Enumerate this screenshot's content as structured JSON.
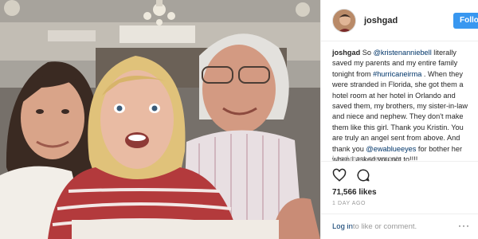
{
  "post": {
    "username": "joshgad",
    "follow_label": "Follow",
    "caption": {
      "user": "joshgad",
      "t1": " So ",
      "mention1": "@kristenanniebell",
      "t2": " literally saved my parents and my entire family tonight from ",
      "hashtag": "#hurricaneirma",
      "t3": " . When they were stranded in Florida, she got them a hotel room at her hotel in Orlando and saved them, my brothers, my sister-in-law and niece and nephew. They don't make them like this girl. Thank you Kristin. You are truly an angel sent from above. And thank you ",
      "mention2": "@ewablueeyes",
      "t4": " for bother her when I asked you not to!!!!"
    },
    "load_more": "Load more comments",
    "likes": "71,566 likes",
    "time": "1 DAY AGO",
    "login_link": "Log in",
    "comment_prompt": " to like or comment.",
    "more_glyph": "···"
  },
  "icons": {
    "like": "heart-icon",
    "comment": "comment-icon",
    "more": "more-options-icon"
  },
  "colors": {
    "follow_button": "#3897f0",
    "link": "#003569",
    "muted": "#999999",
    "border": "#efefef"
  }
}
